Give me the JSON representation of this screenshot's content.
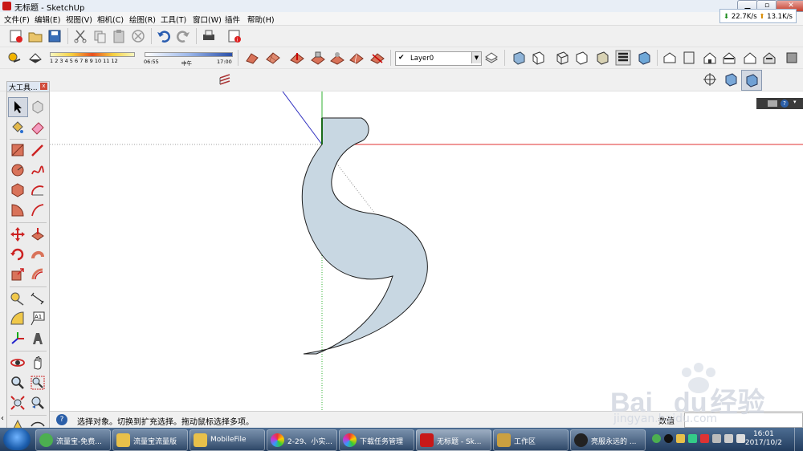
{
  "window": {
    "title": "无标题 - SketchUp"
  },
  "menu": [
    "文件(F)",
    "编辑(E)",
    "视图(V)",
    "相机(C)",
    "绘图(R)",
    "工具(T)",
    "窗口(W)",
    "插件",
    "帮助(H)"
  ],
  "netspeed": {
    "down": "22.7K/s",
    "up": "13.1K/s"
  },
  "shadow": {
    "months": "1 2 3 4 5 6 7 8 9 10 11 12",
    "time_start": "06:55",
    "time_mid": "中午",
    "time_end": "17:00"
  },
  "layer": {
    "current": "Layer0",
    "check": "✔"
  },
  "palette": {
    "title": "大工具...",
    "close": "x"
  },
  "statusbar": {
    "help": "?",
    "message": "选择对象。切换到扩充选择。拖动鼠标选择多项。",
    "vcb_label": "数值"
  },
  "taskbar": {
    "tasks": [
      {
        "label": "流量宝-免费...",
        "color": "#4caf50"
      },
      {
        "label": "流量宝流量版",
        "color": "#e8c04a"
      },
      {
        "label": "MobileFile",
        "color": "#e8c04a"
      },
      {
        "label": "2-29、小实...",
        "color": "#e05a9a"
      },
      {
        "label": "下载任务管理",
        "color": "#e05a9a"
      },
      {
        "label": "无标题 - Sk...",
        "color": "#c81818"
      },
      {
        "label": "工作区",
        "color": "#caa040"
      },
      {
        "label": "亮服永远的 ...",
        "color": "#222222"
      }
    ],
    "time": "16:01",
    "date": "2017/10/2"
  },
  "watermark": {
    "brand": "Bai",
    "brand2": "du",
    "cn": "经验",
    "url": "jingyan.baidu.com"
  }
}
